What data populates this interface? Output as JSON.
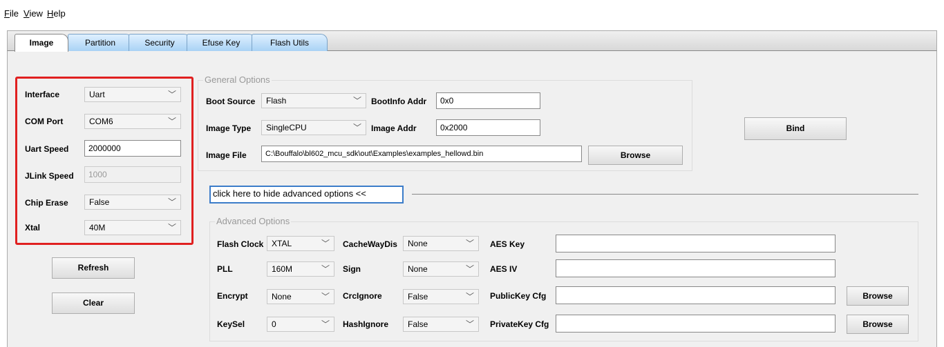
{
  "menu": {
    "file": {
      "mnemonic": "F",
      "rest": "ile"
    },
    "view": {
      "mnemonic": "V",
      "rest": "iew"
    },
    "help": {
      "mnemonic": "H",
      "rest": "elp"
    }
  },
  "tabs": [
    "Image",
    "Partition",
    "Security",
    "Efuse Key",
    "Flash Utils"
  ],
  "left_panel": {
    "interface": {
      "label": "Interface",
      "value": "Uart"
    },
    "com_port": {
      "label": "COM Port",
      "value": "COM6"
    },
    "uart_speed": {
      "label": "Uart Speed",
      "value": "2000000"
    },
    "jlink_speed": {
      "label": "JLink Speed",
      "value": "1000"
    },
    "chip_erase": {
      "label": "Chip Erase",
      "value": "False"
    },
    "xtal": {
      "label": "Xtal",
      "value": "40M"
    },
    "refresh_button": "Refresh",
    "clear_button": "Clear"
  },
  "general": {
    "title": "General Options",
    "boot_source": {
      "label": "Boot Source",
      "value": "Flash"
    },
    "bootinfo_addr": {
      "label": "BootInfo Addr",
      "value": "0x0"
    },
    "image_type": {
      "label": "Image Type",
      "value": "SingleCPU"
    },
    "image_addr": {
      "label": "Image Addr",
      "value": "0x2000"
    },
    "image_file": {
      "label": "Image File",
      "value": "C:\\Bouffalo\\bl602_mcu_sdk\\out\\Examples\\examples_hellowd.bin"
    },
    "browse_button": "Browse"
  },
  "bind_button": "Bind",
  "advanced_toggle": "click here to hide advanced options <<",
  "advanced": {
    "title": "Advanced Options",
    "flash_clock": {
      "label": "Flash Clock",
      "value": "XTAL"
    },
    "pll": {
      "label": "PLL",
      "value": "160M"
    },
    "encrypt": {
      "label": "Encrypt",
      "value": "None"
    },
    "keysel": {
      "label": "KeySel",
      "value": "0"
    },
    "cachewaydis": {
      "label": "CacheWayDis",
      "value": "None"
    },
    "sign": {
      "label": "Sign",
      "value": "None"
    },
    "crcignore": {
      "label": "CrcIgnore",
      "value": "False"
    },
    "hashignore": {
      "label": "HashIgnore",
      "value": "False"
    },
    "aes_key": {
      "label": "AES Key",
      "value": ""
    },
    "aes_iv": {
      "label": "AES IV",
      "value": ""
    },
    "publickey_cfg": {
      "label": "PublicKey Cfg",
      "value": ""
    },
    "privatekey_cfg": {
      "label": "PrivateKey Cfg",
      "value": ""
    },
    "browse_button": "Browse"
  },
  "colors": {
    "highlight_border": "#e02020",
    "tab_blue": "#a9d2f5",
    "focus_blue": "#3b7cc9"
  }
}
